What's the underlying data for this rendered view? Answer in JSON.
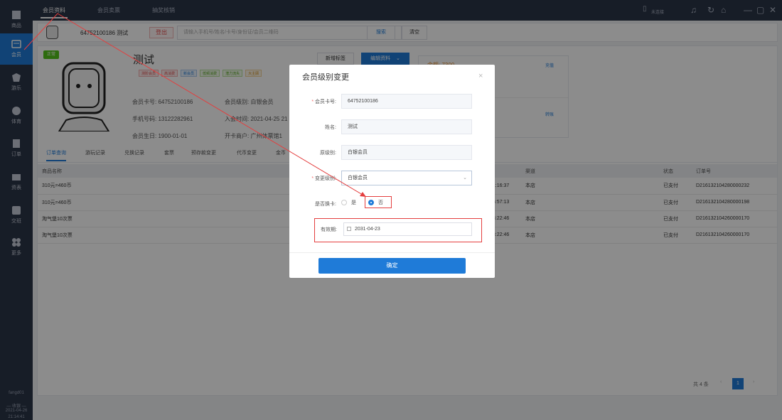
{
  "sidebar": {
    "items": [
      {
        "label": "商品",
        "icon": "goods-icon"
      },
      {
        "label": "会员",
        "icon": "member-icon"
      },
      {
        "label": "游乐",
        "icon": "amusement-icon"
      },
      {
        "label": "体育",
        "icon": "sports-icon"
      },
      {
        "label": "订单",
        "icon": "order-icon"
      },
      {
        "label": "资表",
        "icon": "report-icon"
      },
      {
        "label": "交班",
        "icon": "shift-icon"
      },
      {
        "label": "更多",
        "icon": "more-icon"
      }
    ],
    "footer": {
      "user": "fangd01",
      "divider": "— 收银 —",
      "date": "2021-04-26",
      "time": "21:14:41"
    }
  },
  "topbar": {
    "tabs": [
      "会员资料",
      "会员卖票",
      "抽奖核销"
    ],
    "status": "未连接"
  },
  "member_bar": {
    "card_info": "64752100186 测试",
    "logout_label": "登出",
    "search_placeholder": "请输入手机号/姓名/卡号/身份证/会员二维码",
    "search_label": "搜索",
    "clear_label": "清空"
  },
  "profile": {
    "status_badge": "正常",
    "name": "测试",
    "tags": [
      "测阶会员",
      "高消费",
      "新会员",
      "低频消费",
      "潜力流失",
      "大主顾"
    ],
    "card_no_label": "会员卡号: 64752100186",
    "level_label": "会员级别: 白银会员",
    "phone_label": "手机号码: 13122282961",
    "join_label": "入会时间: 2021-04-25 21",
    "birthday_label": "会员生日: 1900-01-01",
    "open_label": "开卡商户: 广州体票馆1",
    "add_tag_label": "新增标签",
    "edit_label": "编辑资料",
    "balance_label": "余额: 7300",
    "recharge_label": "充值",
    "transfer_label": "转账"
  },
  "subtabs": [
    "订单查询",
    "游玩记录",
    "兑换记录",
    "套票",
    "预存款变更",
    "代币变更",
    "金币"
  ],
  "table": {
    "headers": [
      "商品名称",
      "",
      "渠道",
      "状态",
      "订单号"
    ],
    "rows": [
      {
        "name": "310元=460币",
        "time": "21:16:37",
        "channel": "本店",
        "status": "已支付",
        "order": "D216132104280000232"
      },
      {
        "name": "310元=460币",
        "time": "16:57:13",
        "channel": "本店",
        "status": "已支付",
        "order": "D216132104280000198"
      },
      {
        "name": "淘气堡10次票",
        "time": "13:22:46",
        "channel": "本店",
        "status": "已支付",
        "order": "D216132104260000170"
      },
      {
        "name": "淘气堡10次票",
        "time": "13:22:46",
        "channel": "本店",
        "status": "已支付",
        "order": "D216132104260000170"
      }
    ]
  },
  "pager": {
    "total": "共 4 条",
    "page": "1",
    "prev": "‹",
    "next": "›"
  },
  "modal": {
    "title": "会员级别变更",
    "close": "×",
    "card_label": "会员卡号:",
    "card_value": "64752100186",
    "name_label": "姓名:",
    "name_value": "测试",
    "old_level_label": "原级别:",
    "old_level_value": "白银会员",
    "new_level_label": "变更级别:",
    "new_level_value": "白银会员",
    "change_card_label": "是否换卡:",
    "yes_label": "是",
    "no_label": "否",
    "expiry_label": "有效期:",
    "expiry_value": "2031-04-23",
    "ok_label": "确定"
  },
  "colors": {
    "accent": "#1f7bd8",
    "sidebar": "#2b3548",
    "highlight": "#e43e3e",
    "success": "#52c41a"
  }
}
